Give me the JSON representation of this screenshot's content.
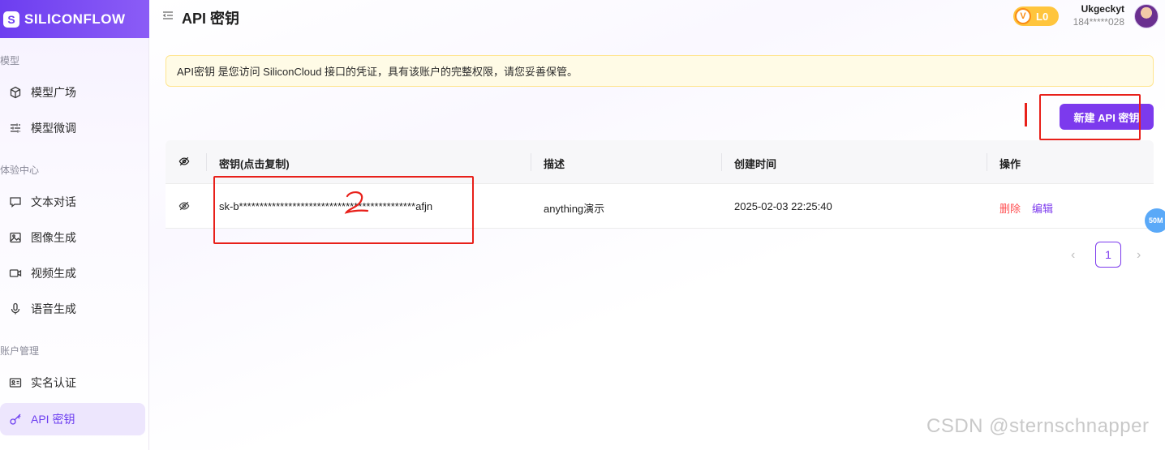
{
  "sidebar": {
    "logo_text": "SILICONFLOW",
    "sections": [
      {
        "label": "模型",
        "items": [
          {
            "label": "模型广场",
            "icon": "cube-icon"
          },
          {
            "label": "模型微调",
            "icon": "sliders-icon"
          }
        ]
      },
      {
        "label": "体验中心",
        "items": [
          {
            "label": "文本对话",
            "icon": "chat-icon"
          },
          {
            "label": "图像生成",
            "icon": "image-icon"
          },
          {
            "label": "视频生成",
            "icon": "video-icon"
          },
          {
            "label": "语音生成",
            "icon": "microphone-icon"
          }
        ]
      },
      {
        "label": "账户管理",
        "items": [
          {
            "label": "实名认证",
            "icon": "id-card-icon"
          },
          {
            "label": "API 密钥",
            "icon": "key-icon",
            "active": true
          }
        ]
      }
    ]
  },
  "header": {
    "title": "API 密钥",
    "level": "L0",
    "user_name": "Ukgeckyt",
    "user_phone": "184*****028"
  },
  "notice": "API密钥 是您访问 SiliconCloud 接口的凭证，具有该账户的完整权限，请您妥善保管。",
  "actions": {
    "new_key_label": "新建 API 密钥"
  },
  "table": {
    "columns": [
      "密钥(点击复制)",
      "描述",
      "创建时间",
      "操作"
    ],
    "rows": [
      {
        "key": "sk-b*******************************************afjn",
        "description": "anything演示",
        "created": "2025-02-03 22:25:40",
        "delete_label": "删除",
        "edit_label": "编辑"
      }
    ]
  },
  "pagination": {
    "current": "1"
  },
  "float_badge": "50M",
  "annotations": {
    "mark_1": "1",
    "mark_2": "2"
  },
  "watermark": "CSDN @sternschnapper",
  "colors": {
    "brand": "#7c3aed",
    "danger": "#ff4d4f",
    "notice_bg": "#fffbe6",
    "annotation": "#e8201a"
  }
}
